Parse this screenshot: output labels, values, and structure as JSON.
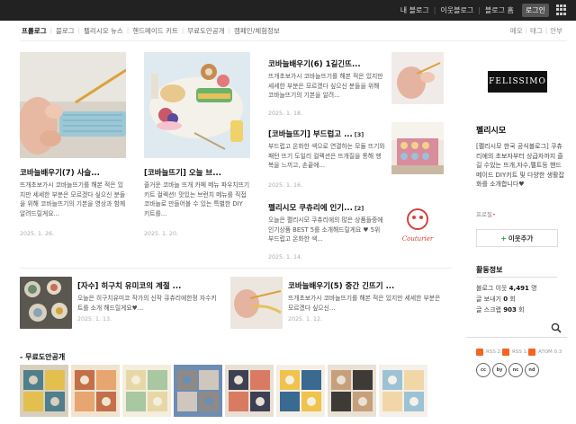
{
  "topbar": {
    "links": [
      "내 블로그",
      "이웃블로그",
      "블로그 홈"
    ],
    "login": "로그인"
  },
  "nav": {
    "items": [
      "프롤로그",
      "블로그",
      "펠리시모 뉴스",
      "핸드메이드 키트",
      "무료도안공개",
      "캠페인/체험정보"
    ],
    "active": 0
  },
  "subnav": [
    "메모",
    "태그",
    "안부"
  ],
  "featured": [
    {
      "title": "코바늘배우기(7) 사슬...",
      "desc": "뜨개초보가시 코바늘뜨기를 해본 적은 있지만 세세한 부분은 모르겠다 싶으신 분들을 위해 코바늘뜨기의 기본을 영상과 함께 알려드릴게요...",
      "date": "2025. 1. 26."
    },
    {
      "title": "[코바늘뜨기] 오늘 브...",
      "desc": "즐거운 코바늘 뜨개 카페 메뉴 파우치뜨기 키트 컬렉션! 맛있는 브런치 메뉴를 직접 코바늘로 만들어볼 수 있는 특별한 DIY 키트를...",
      "date": "2025. 1. 20."
    }
  ],
  "posts": [
    {
      "title": "코바늘배우기(6) 1길긴뜨...",
      "count": "",
      "desc": "뜨개초보가시 코바늘뜨기를 해본 적은 있지만 세세한 부분은 모르겠다 싶으신 분들을 위해 코바늘뜨기의 기본을 알려...",
      "date": "2025. 1. 18."
    },
    {
      "title": "[코바늘뜨기] 부드럽고 ...",
      "count": "[3]",
      "desc": "부드럽고 온화한 색으로 연결하는 모듈 뜨기와 패턴 뜨기 도일리 컬렉션은 뜨개질을 통해 행복을 느끼고, 손끝에...",
      "date": "2025. 1. 16."
    },
    {
      "title": "펠리시모 쿠츄리에 인기...",
      "count": "[2]",
      "desc": "오늘은 펠리시모 쿠츄리에의 많은 상품들중에 인기상품 BEST 5를 소개해드릴게요 ♥ 5위 부드럽고 온화한 색...",
      "date": "2025. 1. 14."
    }
  ],
  "small_posts": [
    {
      "title": "[자수] 히구치 유미코의 계절 ...",
      "desc": "오늘은 히구치유미코 작가의 신작 큐츄리에한정 자수키트를 소개 해드릴게요♥...",
      "date": "2025. 1. 13."
    },
    {
      "title": "코바늘배우기(5) 중간 긴뜨기 ...",
      "desc": "뜨개초보가시 코바늘뜨기를 해본 적은 있지만 세세한 부분은 모르겠다 싶으신...",
      "date": "2025. 1. 12."
    }
  ],
  "profile": {
    "logo": "FELISSIMO",
    "name": "펠리시모",
    "desc": "[펠리시모 한국 공식블로그] 쿠츄리에의 초보자부터 상급자까지 즐길 수있는 뜨개,자수,펠트등 핸드메이드 DIY키트 및 다양한 생활잡화를 소개합니다♥",
    "profile_link": "프로필",
    "follow": "이웃추가"
  },
  "activity": {
    "title": "활동정보",
    "stats": [
      {
        "label": "블로그 이웃",
        "value": "4,491",
        "unit": "명"
      },
      {
        "label": "글 보내기",
        "value": "0",
        "unit": "회"
      },
      {
        "label": "글 스크랩",
        "value": "903",
        "unit": "회"
      }
    ]
  },
  "rss": [
    "RSS 2.0",
    "RSS 1.0",
    "ATOM 0.3"
  ],
  "cc_badges": [
    "cc",
    "by",
    "nc",
    "nd"
  ],
  "patterns": {
    "title": "- 무료도안공개",
    "count": 8
  }
}
